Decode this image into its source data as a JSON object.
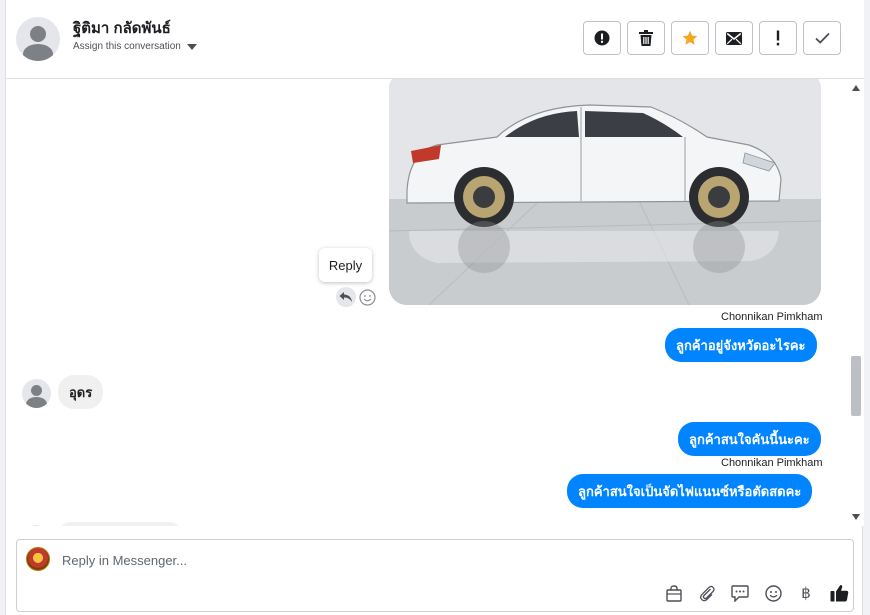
{
  "header": {
    "contact_name": "ฐิติมา กลัดพันธ์",
    "assign_label": "Assign this conversation"
  },
  "actions": [
    {
      "name": "spam",
      "icon": "alert-circle-icon"
    },
    {
      "name": "delete",
      "icon": "trash-icon"
    },
    {
      "name": "star",
      "icon": "star-icon"
    },
    {
      "name": "mark-unread",
      "icon": "envelope-icon"
    },
    {
      "name": "follow-up",
      "icon": "exclamation-icon"
    },
    {
      "name": "done",
      "icon": "check-icon"
    }
  ],
  "thread": {
    "tooltip": "Reply",
    "messages": [
      {
        "sender": "Chonnikan Pimkham",
        "text": "ลูกค้าอยู่จังหวัดอะไรคะ",
        "direction": "out"
      },
      {
        "text": "อุดร",
        "direction": "in"
      },
      {
        "text": "ลูกค้าสนใจคันนี้นะคะ",
        "direction": "out"
      },
      {
        "sender": "Chonnikan Pimkham",
        "text": "ลูกค้าสนใจเป็นจัดไฟแนนซ์หรือตัดสดคะ",
        "direction": "out"
      }
    ]
  },
  "composer": {
    "placeholder": "Reply in Messenger...",
    "tools": [
      "shopping-bag-icon",
      "paperclip-icon",
      "saved-reply-icon",
      "emoji-icon",
      "baht-icon",
      "thumbs-up-icon"
    ],
    "baht_symbol": "฿"
  },
  "colors": {
    "outgoing_bubble": "#0084ff",
    "star_active": "#f5a623"
  }
}
